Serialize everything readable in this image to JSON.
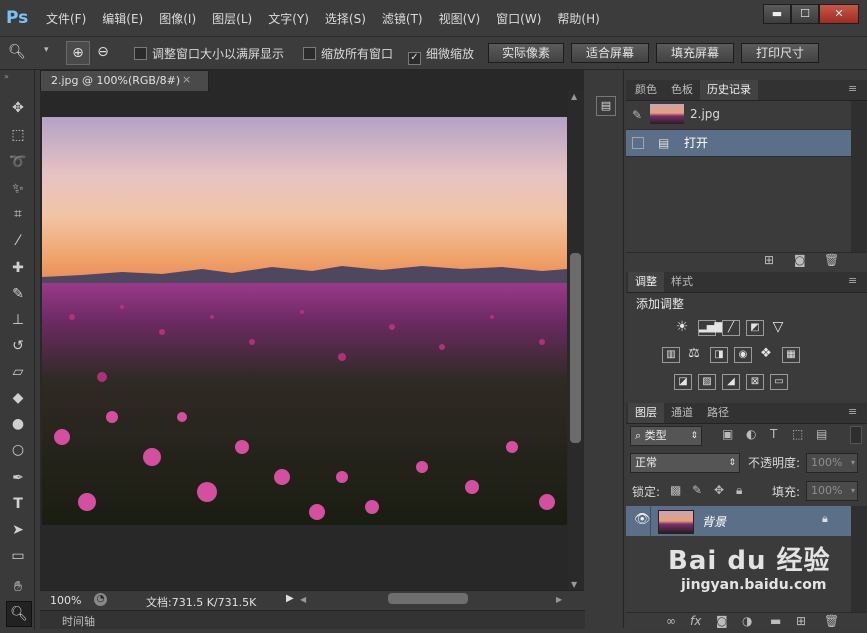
{
  "app": {
    "logo": "Ps"
  },
  "menu": [
    "文件(F)",
    "编辑(E)",
    "图像(I)",
    "图层(L)",
    "文字(Y)",
    "选择(S)",
    "滤镜(T)",
    "视图(V)",
    "窗口(W)",
    "帮助(H)"
  ],
  "window_controls": {
    "minimize": "▬",
    "restore": "☐",
    "close": "✕"
  },
  "options": {
    "resize_windows_label": "调整窗口大小以满屏显示",
    "zoom_all_windows_label": "缩放所有窗口",
    "scrubby_zoom_label": "细微缩放",
    "scrubby_zoom_checked": "✓",
    "actual_pixels": "实际像素",
    "fit_screen": "适合屏幕",
    "fill_screen": "填充屏幕",
    "print_size": "打印尺寸"
  },
  "document": {
    "tab_title": "2.jpg @ 100%(RGB/8#)",
    "tab_close": "×",
    "zoom": "100%",
    "doc_size": "文档:731.5 K/731.5K"
  },
  "timeline_label": "时间轴",
  "history_panel": {
    "tabs": [
      "颜色",
      "色板",
      "历史记录"
    ],
    "active_tab": 2,
    "snapshot_name": "2.jpg",
    "states": [
      "打开"
    ]
  },
  "adjustments_panel": {
    "tabs": [
      "调整",
      "样式"
    ],
    "title": "添加调整"
  },
  "layers_panel": {
    "tabs": [
      "图层",
      "通道",
      "路径"
    ],
    "filter_kind": "类型",
    "blend_mode": "正常",
    "opacity_label": "不透明度:",
    "opacity_value": "100%",
    "lock_label": "锁定:",
    "fill_label": "填充:",
    "fill_value": "100%",
    "layers": [
      {
        "name": "背景",
        "locked": true
      }
    ]
  },
  "watermark": {
    "line1": "Bai du 经验",
    "line2": "jingyan.baidu.com"
  },
  "colors": {
    "ui_bg": "#3a3a3a",
    "selected_row": "#5b6f88",
    "ps_blue": "#7dc0f5"
  }
}
